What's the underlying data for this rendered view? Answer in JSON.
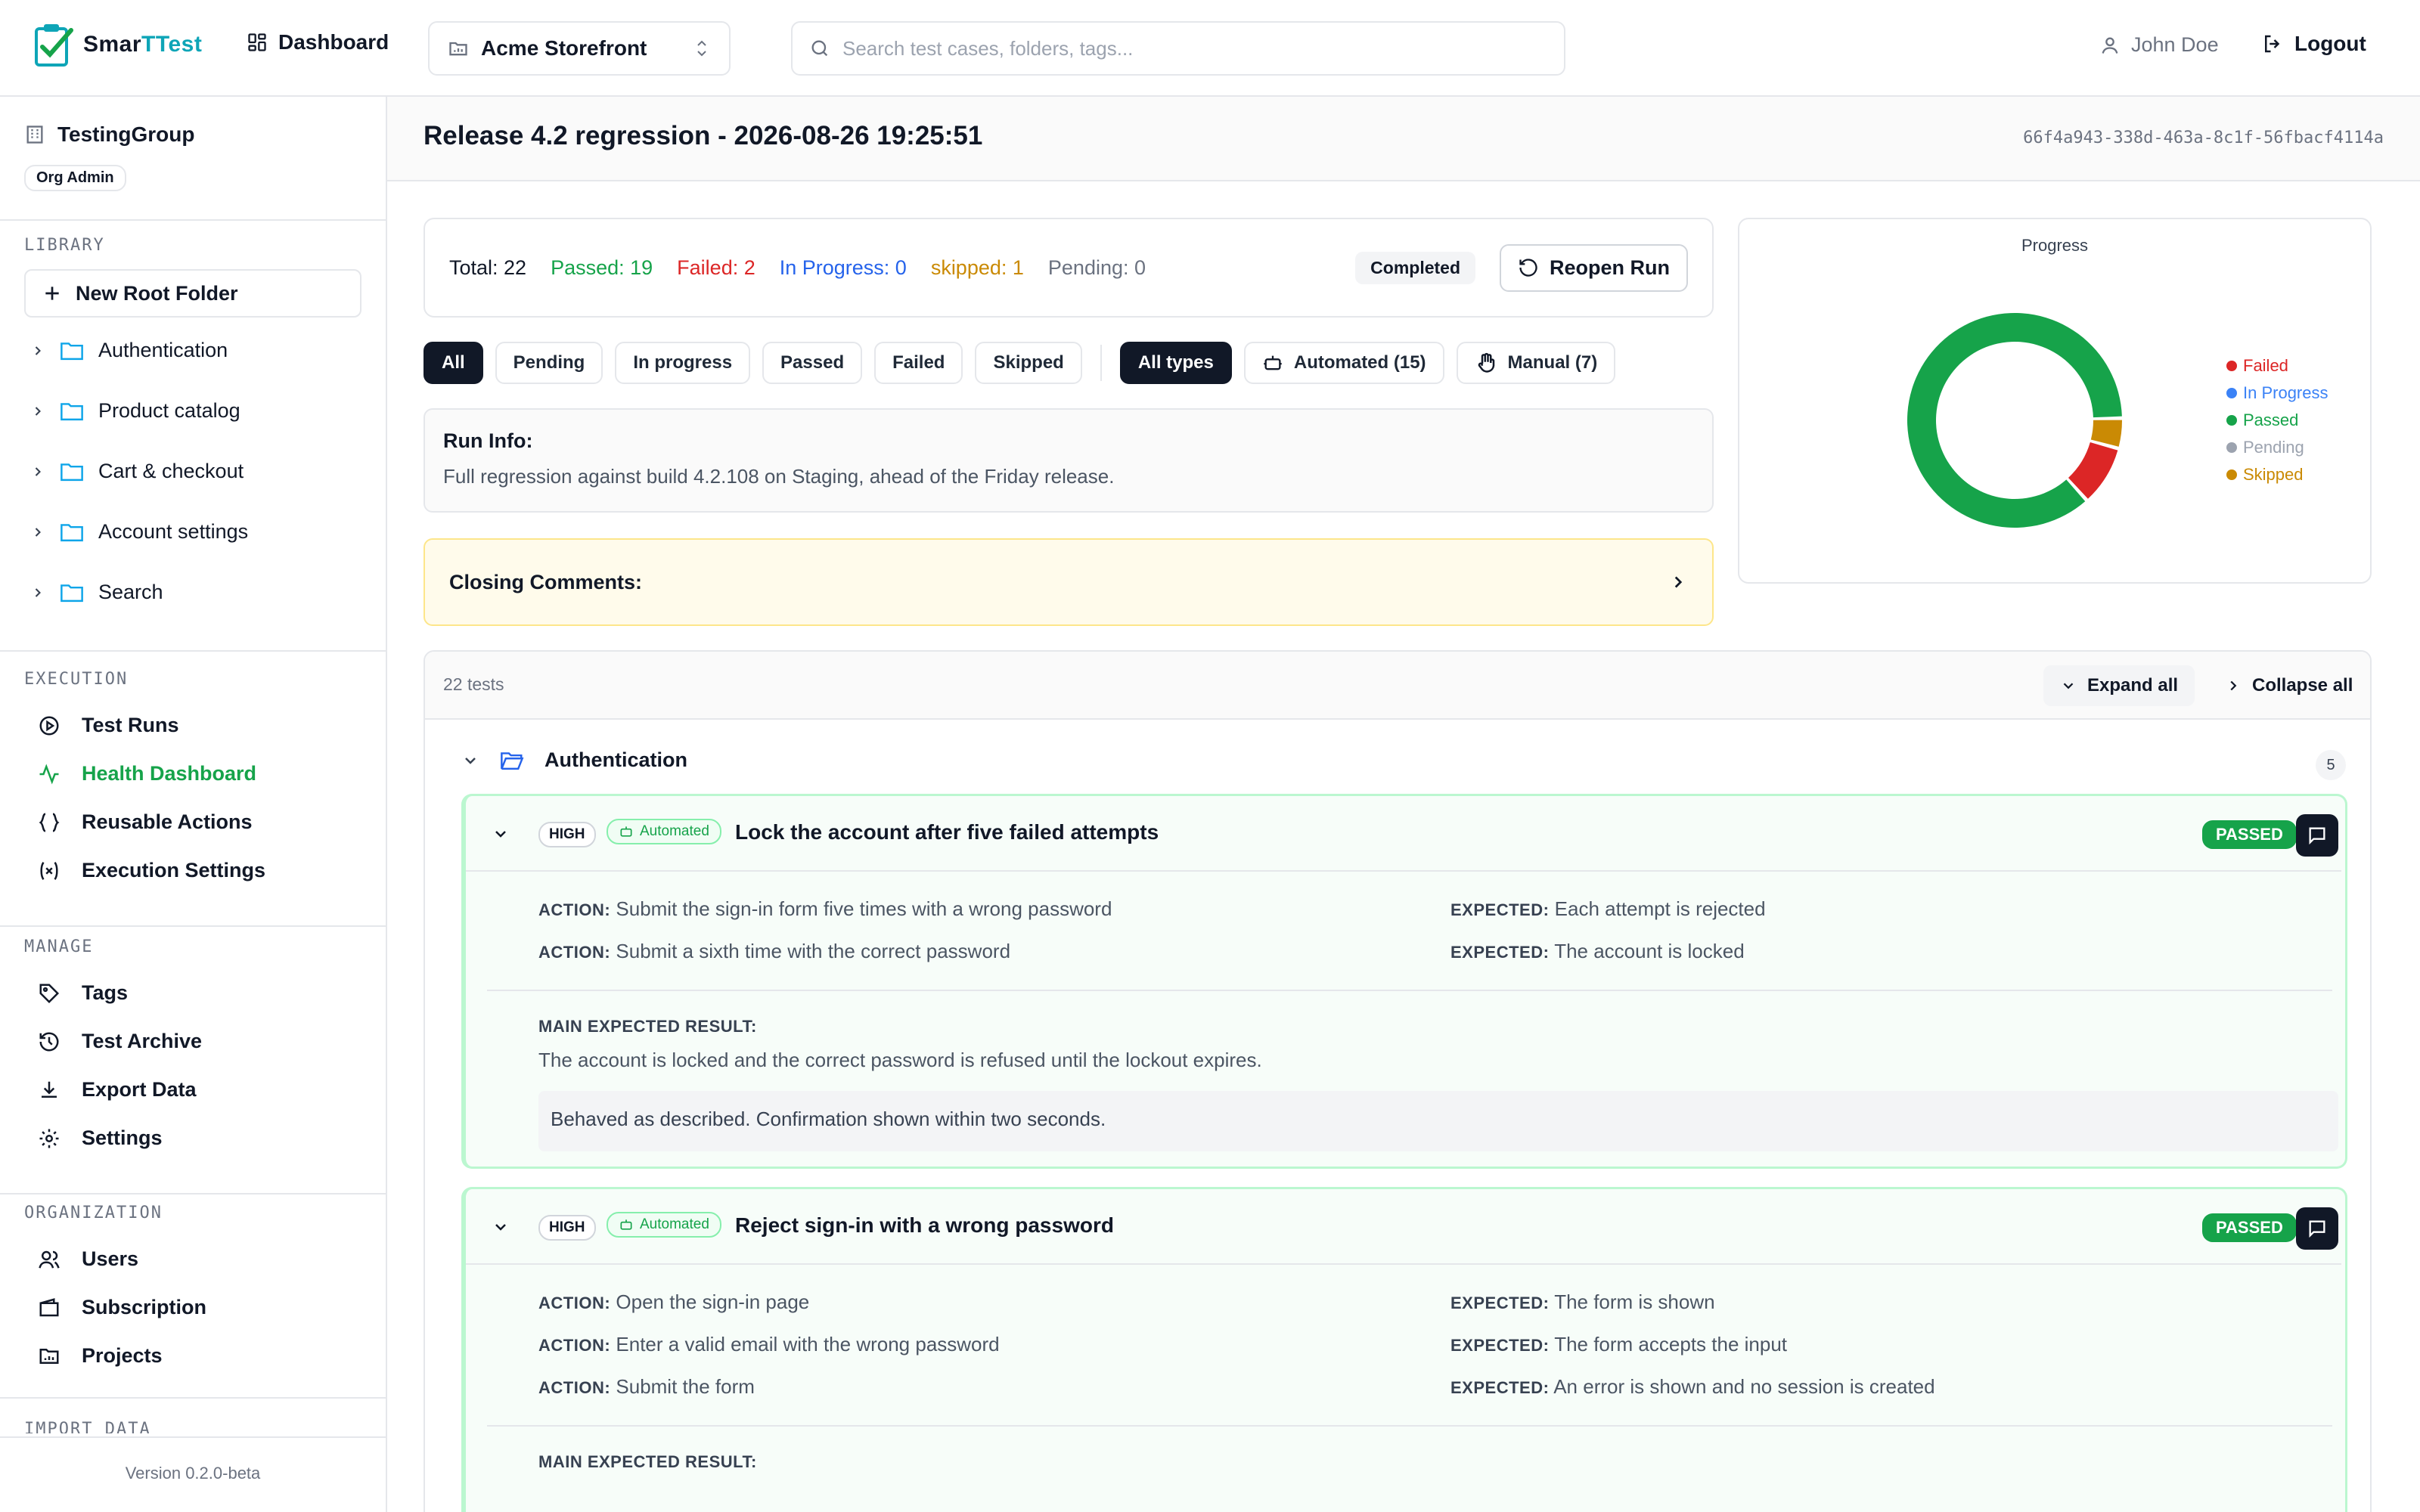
{
  "app": {
    "logo_main": "Smar",
    "logo_accent": "TTest",
    "dashboard_label": "Dashboard",
    "project": "Acme Storefront",
    "search_placeholder": "Search test cases, folders, tags...",
    "user_name": "John Doe",
    "logout_label": "Logout"
  },
  "sidebar": {
    "org_name": "TestingGroup",
    "role": "Org Admin",
    "library_heading": "LIBRARY",
    "new_root_label": "New Root Folder",
    "folders": [
      "Authentication",
      "Product catalog",
      "Cart & checkout",
      "Account settings",
      "Search"
    ],
    "execution_heading": "EXECUTION",
    "execution_items": [
      "Test Runs",
      "Health Dashboard",
      "Reusable Actions",
      "Execution Settings"
    ],
    "manage_heading": "MANAGE",
    "manage_items": [
      "Tags",
      "Test Archive",
      "Export Data",
      "Settings"
    ],
    "organization_heading": "ORGANIZATION",
    "organization_items": [
      "Users",
      "Subscription",
      "Projects"
    ],
    "import_heading": "IMPORT DATA",
    "version": "Version 0.2.0-beta"
  },
  "run": {
    "title": "Release 4.2 regression - 2026-08-26 19:25:51",
    "id": "66f4a943-338d-463a-8c1f-56fbacf4114a",
    "stats": {
      "total": "Total: 22",
      "passed": "Passed: 19",
      "failed": "Failed: 2",
      "in_progress": "In Progress: 0",
      "skipped": "skipped: 1",
      "pending": "Pending: 0"
    },
    "status": "Completed",
    "reopen_label": "Reopen Run",
    "filters": [
      "All",
      "Pending",
      "In progress",
      "Passed",
      "Failed",
      "Skipped"
    ],
    "type_filters": {
      "all": "All types",
      "automated": "Automated (15)",
      "manual": "Manual (7)"
    },
    "info_heading": "Run Info:",
    "info_text": "Full regression against build 4.2.108 on Staging, ahead of the Friday release.",
    "closing_label": "Closing Comments:"
  },
  "chart_data": {
    "type": "pie",
    "title": "Progress",
    "legend_position": "right",
    "categories": [
      "Failed",
      "In Progress",
      "Passed",
      "Pending",
      "Skipped"
    ],
    "values": [
      2,
      0,
      19,
      0,
      1
    ],
    "colors": [
      "#dc2626",
      "#3b82f6",
      "#16a34a",
      "#9ca3af",
      "#ca8a04"
    ]
  },
  "tests": {
    "count": "22 tests",
    "expand_label": "Expand all",
    "collapse_label": "Collapse all",
    "group_name": "Authentication",
    "group_count": "5",
    "action_key": "ACTION:",
    "expected_key": "EXPECTED:",
    "main_expected_key": "MAIN EXPECTED RESULT:",
    "cases": [
      {
        "priority": "HIGH",
        "type": "Automated",
        "title": "Lock the account after five failed attempts",
        "status": "PASSED",
        "steps": [
          {
            "action": "Submit the sign-in form five times with a wrong password",
            "expected": "Each attempt is rejected"
          },
          {
            "action": "Submit a sixth time with the correct password",
            "expected": "The account is locked"
          }
        ],
        "main_expected": "The account is locked and the correct password is refused until the lockout expires.",
        "note": "Behaved as described. Confirmation shown within two seconds."
      },
      {
        "priority": "HIGH",
        "type": "Automated",
        "title": "Reject sign-in with a wrong password",
        "status": "PASSED",
        "steps": [
          {
            "action": "Open the sign-in page",
            "expected": "The form is shown"
          },
          {
            "action": "Enter a valid email with the wrong password",
            "expected": "The form accepts the input"
          },
          {
            "action": "Submit the form",
            "expected": "An error is shown and no session is created"
          }
        ]
      }
    ]
  },
  "icons": {
    "chevron": "chevron-right-icon",
    "folder": "folder-icon"
  }
}
